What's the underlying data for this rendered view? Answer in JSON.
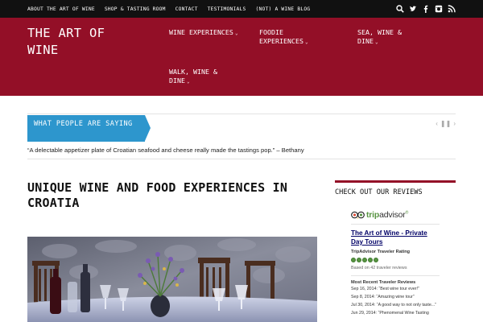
{
  "top_nav": {
    "links": [
      "ABOUT THE ART OF WINE",
      "SHOP & TASTING ROOM",
      "CONTACT",
      "TESTIMONIALS",
      "(NOT) A WINE BLOG"
    ],
    "icons": [
      "search-icon",
      "twitter-icon",
      "facebook-icon",
      "instagram-icon",
      "rss-icon"
    ]
  },
  "header": {
    "logo": "THE ART OF WINE",
    "nav": [
      {
        "label": "WINE EXPERIENCES"
      },
      {
        "label": "FOODIE EXPERIENCES"
      },
      {
        "label": "SEA, WINE & DINE"
      },
      {
        "label": "WALK, WINE & DINE"
      }
    ],
    "caret_icon": "chevron-down-icon"
  },
  "testimonials": {
    "label": "WHAT PEOPLE ARE SAYING",
    "quote": "“A delectable appetizer plate of Croatian seafood and cheese really made the tastings pop.” – Bethany",
    "controls": [
      "prev-icon",
      "pause-icon",
      "next-icon"
    ]
  },
  "main": {
    "title": "UNIQUE WINE AND FOOD EXPERIENCES IN CROATIA"
  },
  "sidebar": {
    "heading": "CHECK OUT OUR REVIEWS",
    "tripadvisor": {
      "logo_trip": "trip",
      "logo_advisor": "advisor",
      "business_name": "The Art of Wine - Private Day Tours",
      "rating_label": "TripAdvisor Traveler Rating",
      "rating": 5,
      "based_on": "Based on 42 traveler reviews",
      "recent_title": "Most Recent Traveler Reviews",
      "reviews": [
        "Sep 16, 2014: “Best wine tour ever!”",
        "Sep 8, 2014: “Amazing wine tour”",
        "Jul 30, 2014: “A good way to not only taste...”",
        "Jun 29, 2014: “Phenomenal Wine Tasting"
      ]
    }
  },
  "colors": {
    "header_bg": "#930f27",
    "topbar_bg": "#111111",
    "testimonial_tag": "#2d96cd",
    "tripadvisor_green": "#589442",
    "link_navy": "#000066"
  }
}
